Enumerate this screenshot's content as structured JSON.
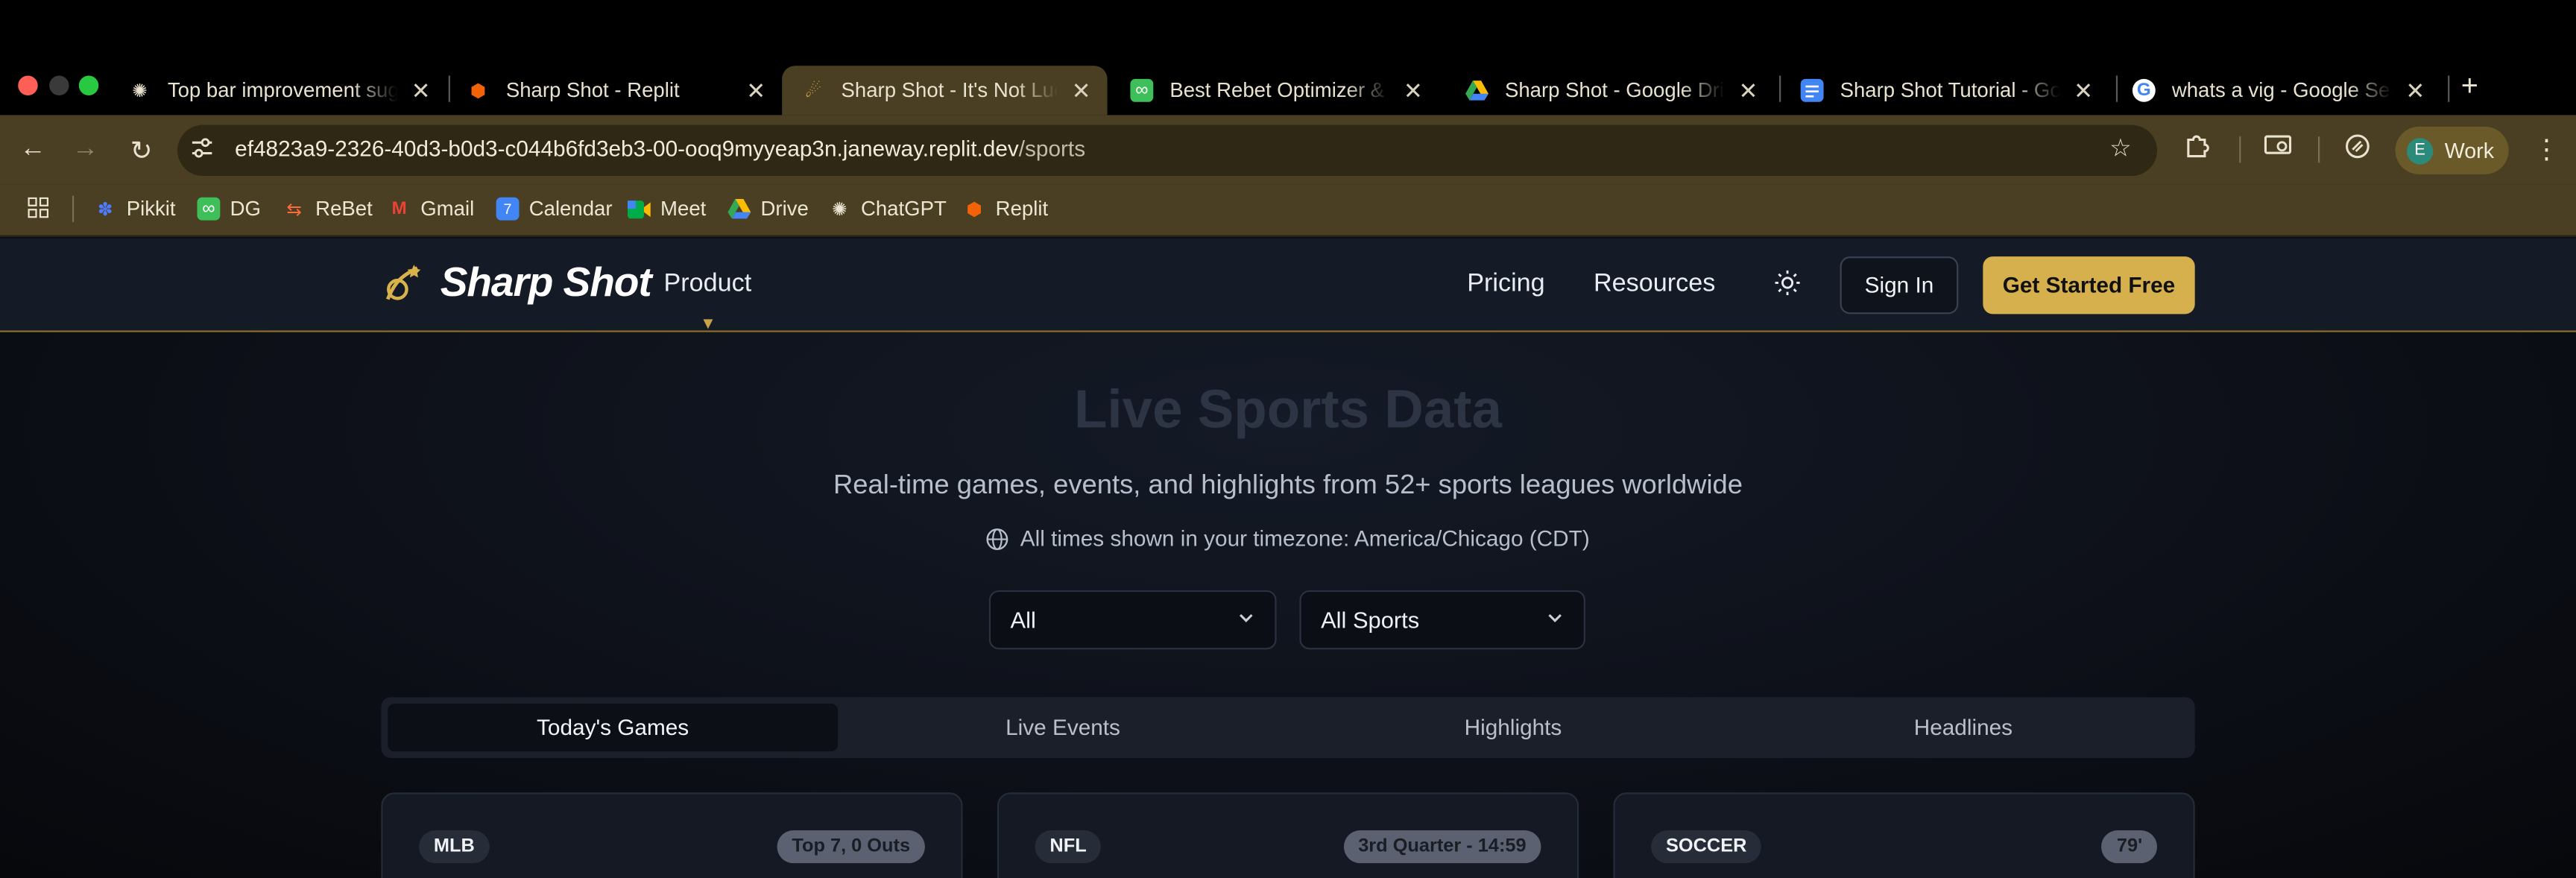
{
  "browser": {
    "tabs": [
      {
        "title": "Top bar improvement sugg",
        "icon": "chatgpt-icon"
      },
      {
        "title": "Sharp Shot - Replit",
        "icon": "replit-icon"
      },
      {
        "title": "Sharp Shot - It's Not Luck",
        "icon": "sharpshot-icon"
      },
      {
        "title": "Best Rebet Optimizer & To",
        "icon": "link-icon"
      },
      {
        "title": "Sharp Shot - Google Drive",
        "icon": "drive-icon"
      },
      {
        "title": "Sharp Shot Tutorial - Goog",
        "icon": "docs-icon"
      },
      {
        "title": "whats a vig - Google Searc",
        "icon": "google-icon"
      }
    ],
    "url_host": "ef4823a9-2326-40d3-b0d3-c044b6fd3eb3-00-ooq9myyeap3n.janeway.replit.dev",
    "url_path": "/sports",
    "profile": {
      "initial": "E",
      "label": "Work"
    },
    "bookmarks": [
      "Pikkit",
      "DG",
      "ReBet",
      "Gmail",
      "Calendar",
      "Meet",
      "Drive",
      "ChatGPT",
      "Replit"
    ]
  },
  "site": {
    "brand": "Sharp Shot",
    "nav": {
      "product": "Product",
      "pricing": "Pricing",
      "resources": "Resources"
    },
    "sign_in": "Sign In",
    "get_started": "Get Started Free",
    "hero_title": "Live Sports Data",
    "hero_subtitle": "Real-time games, events, and highlights from 52+ sports leagues worldwide",
    "timezone": "All times shown in your timezone: America/Chicago (CDT)",
    "filter_status": "All",
    "filter_sport": "All Sports",
    "tabs": [
      "Today's Games",
      "Live Events",
      "Highlights",
      "Headlines"
    ],
    "active_tab": "Today's Games",
    "cards": [
      {
        "league": "MLB",
        "status": "Top 7, 0 Outs"
      },
      {
        "league": "NFL",
        "status": "3rd Quarter - 14:59"
      },
      {
        "league": "SOCCER",
        "status": "79'"
      }
    ]
  },
  "colors": {
    "accent": "#d6b04d",
    "chrome": "#4a3f22",
    "nav_bg": "#141a26"
  }
}
